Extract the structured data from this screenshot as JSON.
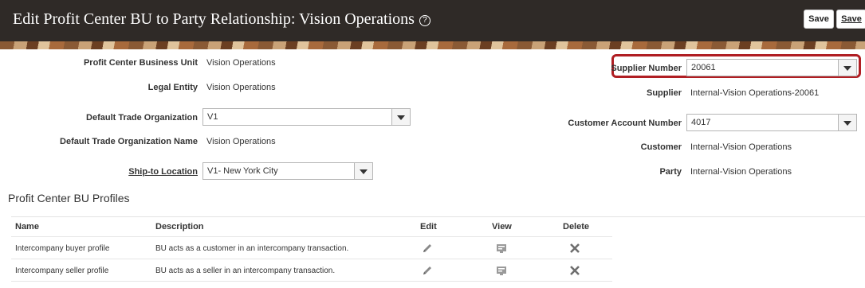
{
  "header": {
    "title": "Edit Profit Center BU to Party Relationship: Vision Operations",
    "help_icon": "question-circle-icon",
    "save_label": "Save",
    "save_close_label": "Save"
  },
  "form": {
    "left": {
      "profit_center_bu_label": "Profit Center Business Unit",
      "profit_center_bu_value": "Vision Operations",
      "legal_entity_label": "Legal Entity",
      "legal_entity_value": "Vision Operations",
      "default_trade_org_label": "Default Trade Organization",
      "default_trade_org_value": "V1",
      "default_trade_org_name_label": "Default Trade Organization Name",
      "default_trade_org_name_value": "Vision Operations",
      "ship_to_label": "Ship-to Location",
      "ship_to_value": "V1- New York City"
    },
    "right": {
      "supplier_number_label": "Supplier Number",
      "supplier_number_value": "20061",
      "supplier_label": "Supplier",
      "supplier_value": "Internal-Vision Operations-20061",
      "customer_account_label": "Customer Account Number",
      "customer_account_value": "4017",
      "customer_label": "Customer",
      "customer_value": "Internal-Vision Operations",
      "party_label": "Party",
      "party_value": "Internal-Vision Operations"
    },
    "highlight_color": "#b01e23"
  },
  "profiles": {
    "title": "Profit Center BU Profiles",
    "columns": [
      "Name",
      "Description",
      "Edit",
      "View",
      "Delete"
    ],
    "rows": [
      {
        "name": "Intercompany buyer profile",
        "description": "BU acts as a customer in an intercompany transaction."
      },
      {
        "name": "Intercompany seller profile",
        "description": "BU acts as a seller in an intercompany transaction."
      }
    ],
    "icons": {
      "edit": "pencil-icon",
      "view": "view-details-icon",
      "delete": "close-x-icon"
    }
  }
}
